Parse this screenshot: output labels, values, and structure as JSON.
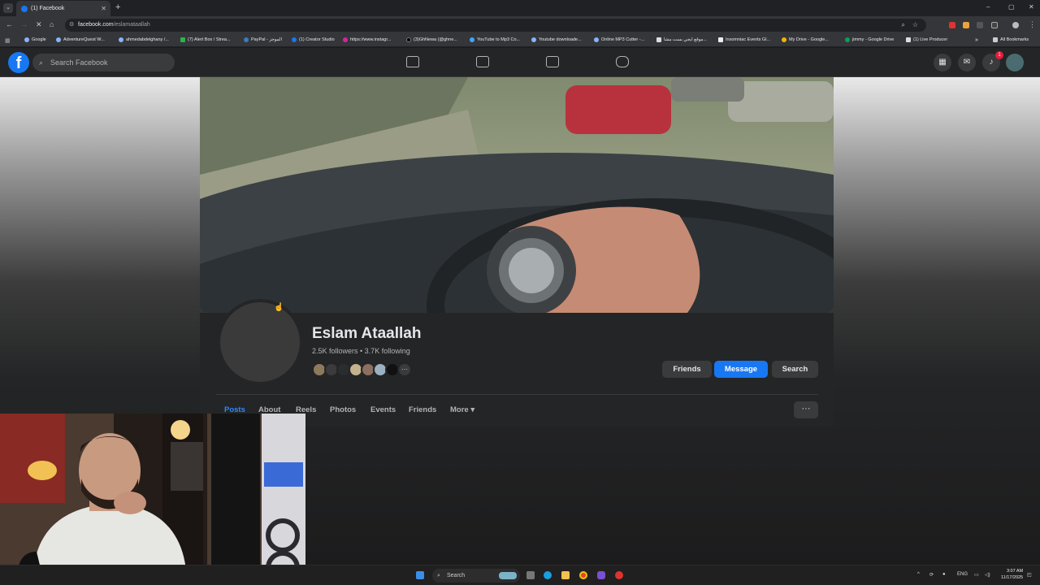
{
  "browser": {
    "tab_title": "(1) Facebook",
    "url_domain": "facebook.com",
    "url_path": "/eslamataallah",
    "bookmarks": [
      "Google",
      "AdventureQuest W...",
      "ahmedabdelghany /...",
      "(7) Alert Box / Strea...",
      "PayPal - الموجز",
      "(1) Creator Studio",
      "https://www.instagr...",
      "(3)GhNewa (@ghne...",
      "YouTube to Mp3 Co...",
      "Youtube downloade...",
      "Online MP3 Cutter -...",
      "موقع ايجي بست مشا...",
      "Insomniac Events Gl...",
      "My Drive - Google...",
      "jimmy - Google Drive",
      "(1) Live Producer"
    ],
    "all_bookmarks_label": "All Bookmarks"
  },
  "facebook": {
    "search_placeholder": "Search Facebook",
    "notification_count": "1",
    "profile": {
      "name": "Eslam Ataallah",
      "stats": "2.5K followers • 3.7K following",
      "friends_button": "Friends",
      "message_button": "Message",
      "search_button": "Search"
    },
    "tabs": [
      "Posts",
      "About",
      "Reels",
      "Photos",
      "Events",
      "Friends",
      "More ▾"
    ],
    "more_options": "···"
  },
  "taskbar": {
    "search_label": "Search",
    "language": "ENG",
    "time": "3:07 AM",
    "date": "11/17/2025"
  },
  "colors": {
    "fb_blue": "#1877f2",
    "header_bg": "#242526",
    "notification_red": "#e41e3f"
  }
}
